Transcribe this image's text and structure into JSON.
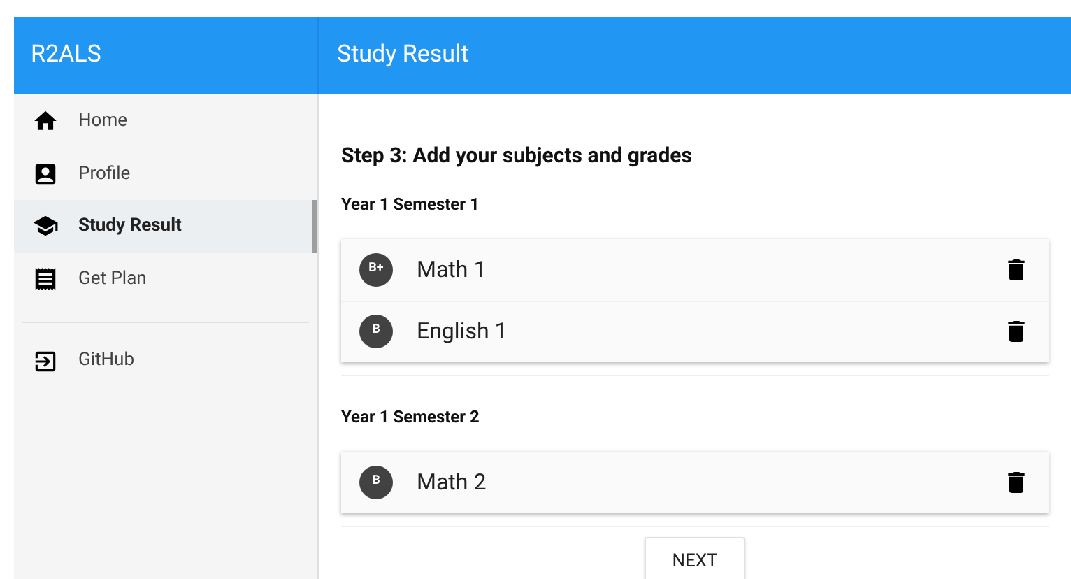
{
  "app": {
    "title": "R2ALS"
  },
  "header": {
    "title": "Study Result"
  },
  "sidebar": {
    "items": [
      {
        "label": "Home",
        "selected": false
      },
      {
        "label": "Profile",
        "selected": false
      },
      {
        "label": "Study Result",
        "selected": true
      },
      {
        "label": "Get Plan",
        "selected": false
      }
    ],
    "links": [
      {
        "label": "GitHub"
      }
    ]
  },
  "step": {
    "title": "Step 3: Add your subjects and grades"
  },
  "semesters": [
    {
      "title": "Year 1 Semester 1",
      "subjects": [
        {
          "grade": "B+",
          "name": "Math 1"
        },
        {
          "grade": "B",
          "name": "English 1"
        }
      ]
    },
    {
      "title": "Year 1 Semester 2",
      "subjects": [
        {
          "grade": "B",
          "name": "Math 2"
        }
      ]
    }
  ],
  "next_button": {
    "label": "NEXT"
  }
}
